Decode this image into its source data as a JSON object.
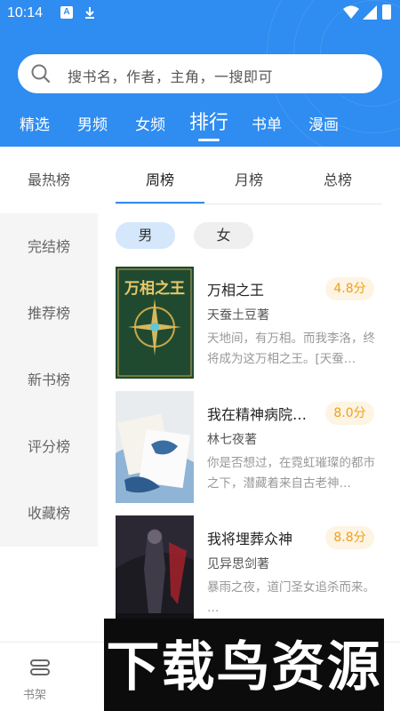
{
  "status_bar": {
    "time": "10:14",
    "notif_icons": [
      "a-icon",
      "download-icon"
    ],
    "right_icons": [
      "wifi-icon",
      "signal-icon",
      "battery-icon"
    ]
  },
  "search": {
    "placeholder": "搜书名，作者，主角，一搜即可"
  },
  "tabs": [
    "精选",
    "男频",
    "女频",
    "排行",
    "书单",
    "漫画"
  ],
  "active_tab": "排行",
  "sidebar": [
    "最热榜",
    "完结榜",
    "推荐榜",
    "新书榜",
    "评分榜",
    "收藏榜"
  ],
  "rank_tabs": [
    "周榜",
    "月榜",
    "总榜"
  ],
  "gender": [
    "男",
    "女"
  ],
  "books": [
    {
      "title": "万相之王",
      "score": "4.8分",
      "author": "天蚕土豆著",
      "desc": "天地间，有万相。而我李洛，终将成为这万相之王。[天蚕…",
      "cover_text": "万相之王"
    },
    {
      "title": "我在精神病院…",
      "score": "8.0分",
      "author": "林七夜著",
      "desc": "你是否想过，在霓虹璀璨的都市之下，潜藏着来自古老神…",
      "cover_text": ""
    },
    {
      "title": "我将埋葬众神",
      "score": "8.8分",
      "author": "见异思剑著",
      "desc": "暴雨之夜，道门圣女追杀而来。 …",
      "cover_text": ""
    }
  ],
  "bottom_nav": {
    "shelf_label": "书架"
  },
  "watermark": "下载鸟资源",
  "colors": {
    "primary": "#2f8cf0",
    "score": "#f0a01a",
    "score_bg": "#fdf4e3",
    "male_chip": "#d4e7fb"
  }
}
